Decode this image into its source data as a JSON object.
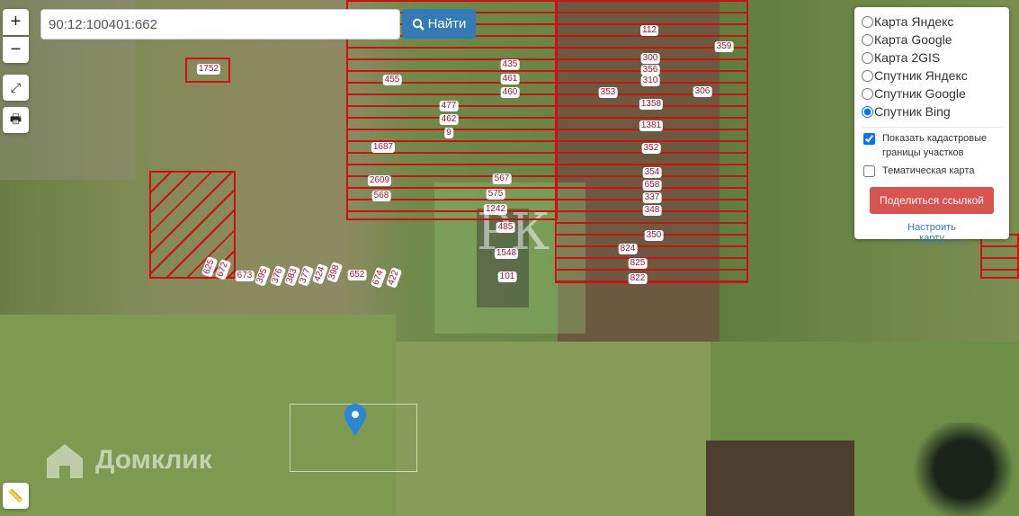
{
  "search": {
    "value": "90:12:100401:662",
    "button_label": "Найти"
  },
  "controls": {
    "zoom_in": "+",
    "zoom_out": "−"
  },
  "layers": {
    "options": [
      "Карта Яндекс",
      "Карта Google",
      "Карта 2GIS",
      "Спутник Яндекс",
      "Спутник Google",
      "Спутник Bing"
    ],
    "selected": "Спутник Bing"
  },
  "checkboxes": {
    "cadastral": {
      "label": "Показать кадастровые границы участков",
      "checked": true
    },
    "thematic": {
      "label": "Тематическая карта",
      "checked": false
    }
  },
  "share_label": "Поделиться ссылкой",
  "configure_label": "Настроить карту",
  "watermark": "Домклик",
  "parcel_labels": [
    "1752",
    "455",
    "435",
    "461",
    "460",
    "477",
    "462",
    "9",
    "1687",
    "2609",
    "568",
    "567",
    "575",
    "1242",
    "485",
    "1548",
    "101",
    "112",
    "359",
    "300",
    "356",
    "310",
    "353",
    "306",
    "1358",
    "1381",
    "352",
    "354",
    "658",
    "337",
    "348",
    "350",
    "824",
    "825",
    "822",
    "625",
    "672",
    "673",
    "395",
    "376",
    "383",
    "377",
    "424",
    "398",
    "652",
    "674",
    "422"
  ],
  "colors": {
    "parcel": "#d01010",
    "button": "#337ab7",
    "share": "#d9534f"
  }
}
